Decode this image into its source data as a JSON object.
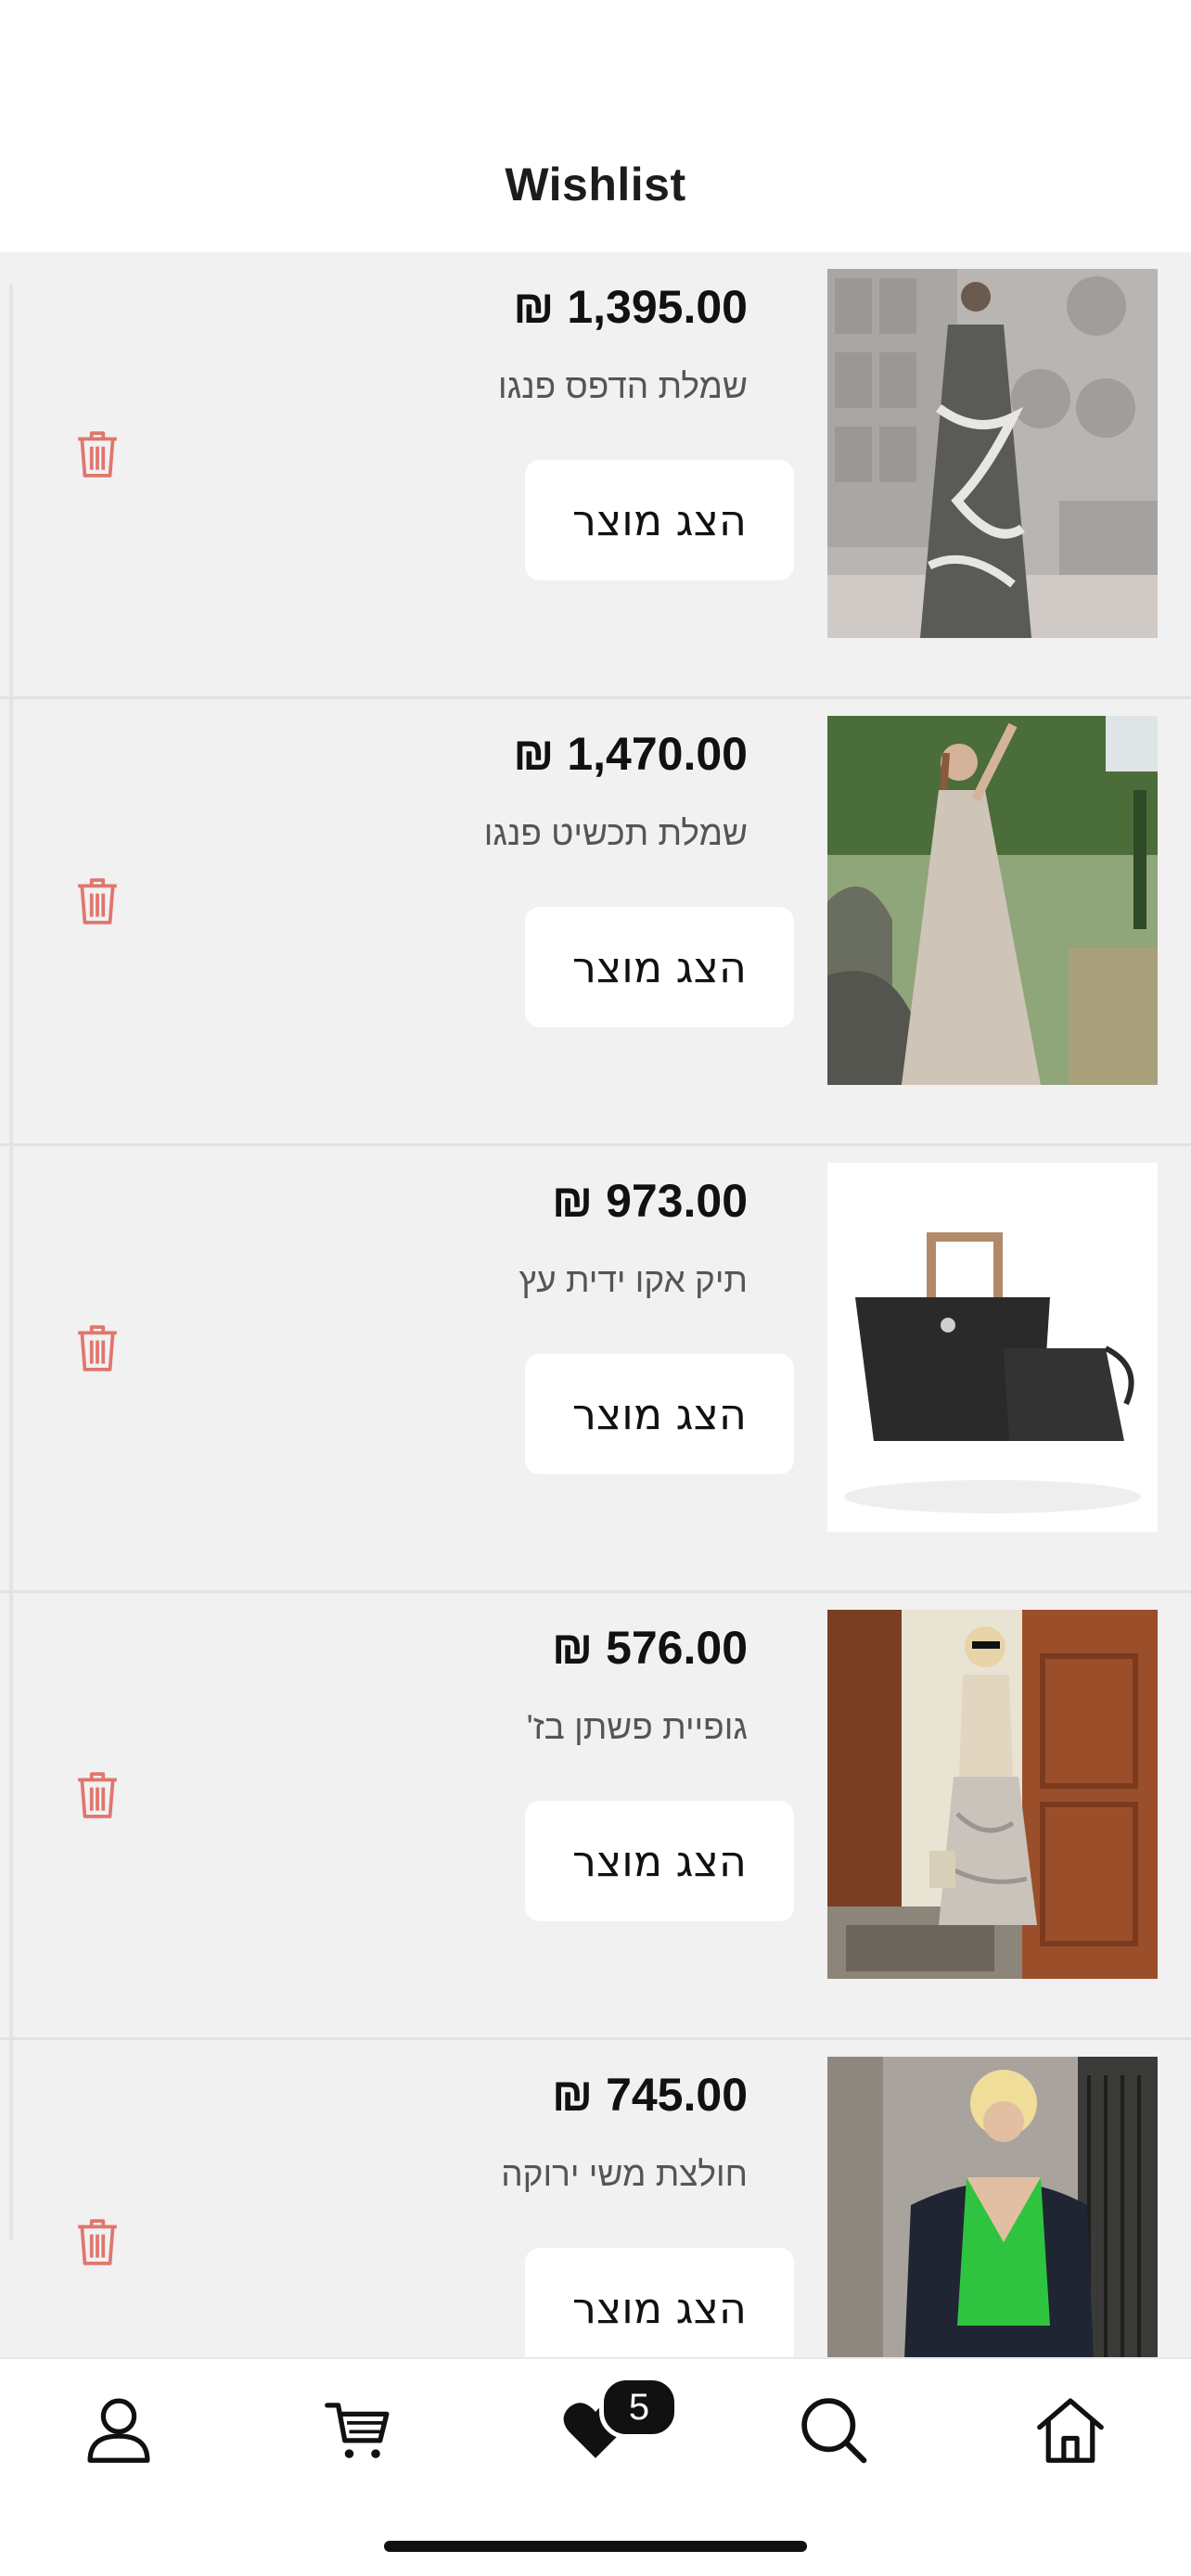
{
  "header": {
    "title": "Wishlist"
  },
  "items": [
    {
      "price": "₪ 1,395.00",
      "name": "שמלת הדפס פנגו",
      "button": "הצג מוצר",
      "image": "dress-print-photo"
    },
    {
      "price": "₪ 1,470.00",
      "name": "שמלת תכשיט פנגו",
      "button": "הצג מוצר",
      "image": "beige-dress-photo"
    },
    {
      "price": "₪ 973.00",
      "name": "תיק אקו ידית עץ",
      "button": "הצג מוצר",
      "image": "black-bag-photo"
    },
    {
      "price": "₪ 576.00",
      "name": "גופיית פשתן בז'",
      "button": "הצג מוצר",
      "image": "linen-top-photo"
    },
    {
      "price": "₪ 745.00",
      "name": "חולצת משי ירוקה",
      "button": "הצג מוצר",
      "image": "green-shirt-photo"
    }
  ],
  "tabbar": {
    "tabs": [
      "user-icon",
      "cart-icon",
      "heart-icon",
      "search-icon",
      "home-icon"
    ],
    "wishlist_count": "5"
  },
  "colors": {
    "accent_trash": "#e0766e",
    "list_bg": "#f1f1f1",
    "badge_bg": "#111111"
  }
}
